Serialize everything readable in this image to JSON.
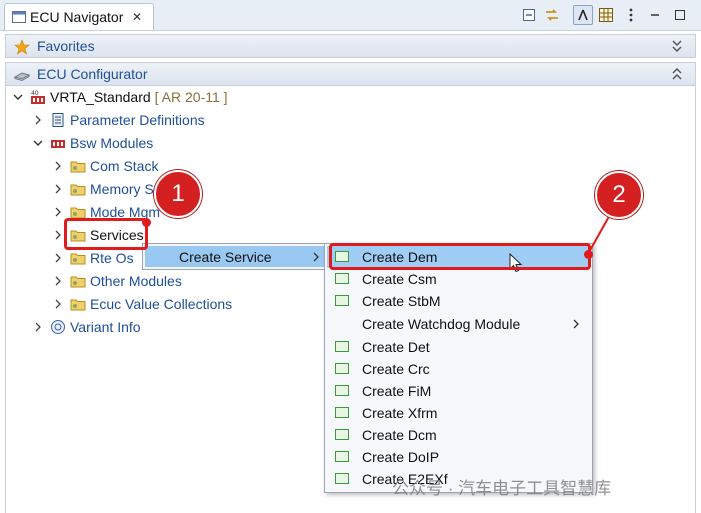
{
  "tab": {
    "title": "ECU Navigator",
    "close": "✕"
  },
  "sections": {
    "favorites": "Favorites",
    "configurator": "ECU Configurator"
  },
  "tree": {
    "root": {
      "label": "VRTA_Standard",
      "version": "[ AR 20-11 ]"
    },
    "parameter_definitions": "Parameter Definitions",
    "bsw_modules": "Bsw Modules",
    "children": [
      "Com Stack",
      "Memory Stack",
      "Mode Mgm",
      "Services",
      "Rte Os",
      "Other Modules",
      "Ecuc Value Collections"
    ],
    "variant_info": "Variant Info"
  },
  "menu1": {
    "item": "Create Service"
  },
  "menu2": {
    "items": [
      {
        "label": "Create Dem",
        "icon": true,
        "submenu": false
      },
      {
        "label": "Create Csm",
        "icon": true,
        "submenu": false
      },
      {
        "label": "Create StbM",
        "icon": true,
        "submenu": false
      },
      {
        "label": "Create Watchdog Module",
        "icon": false,
        "submenu": true
      },
      {
        "label": "Create Det",
        "icon": true,
        "submenu": false
      },
      {
        "label": "Create Crc",
        "icon": true,
        "submenu": false
      },
      {
        "label": "Create FiM",
        "icon": true,
        "submenu": false
      },
      {
        "label": "Create Xfrm",
        "icon": true,
        "submenu": false
      },
      {
        "label": "Create Dcm",
        "icon": true,
        "submenu": false
      },
      {
        "label": "Create DoIP",
        "icon": true,
        "submenu": false
      },
      {
        "label": "Create E2EXf",
        "icon": true,
        "submenu": false
      }
    ]
  },
  "callouts": {
    "one": "1",
    "two": "2"
  },
  "watermark": "公众号 · 汽车电子工具智慧库",
  "colors": {
    "accent_blue": "#1f4f9a",
    "highlight": "#99c8f2",
    "callout_red": "#d42020"
  }
}
